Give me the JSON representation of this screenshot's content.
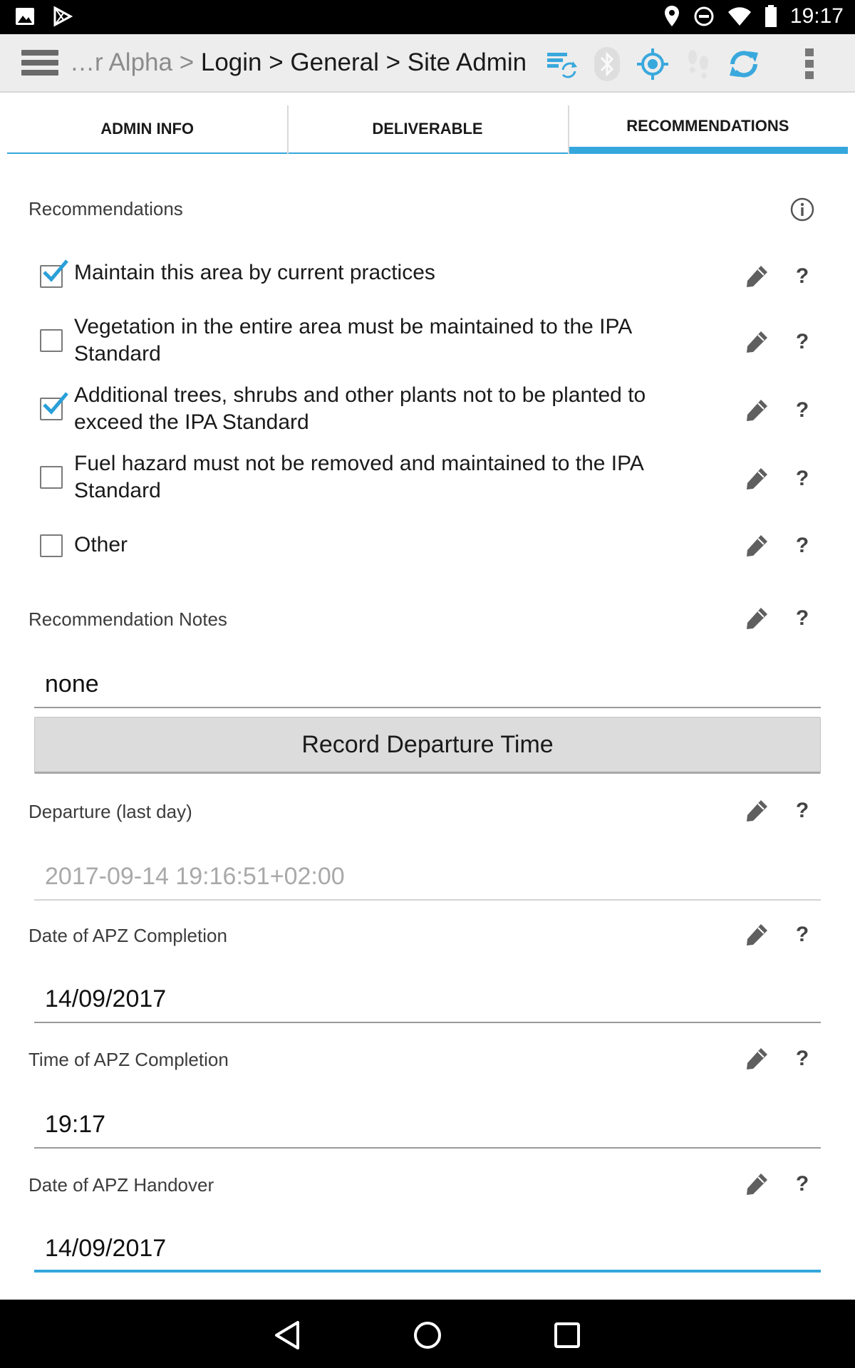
{
  "statusbar": {
    "time": "19:17"
  },
  "actionbar": {
    "breadcrumb_prefix": "…r Alpha > ",
    "breadcrumb_path": "Login > General > Site Admin"
  },
  "tabs": [
    {
      "label": "ADMIN INFO",
      "active": false
    },
    {
      "label": "DELIVERABLE",
      "active": false
    },
    {
      "label": "RECOMMENDATIONS",
      "active": true
    }
  ],
  "recommendations": {
    "label": "Recommendations",
    "items": [
      {
        "text": "Maintain this area by current practices",
        "checked": true
      },
      {
        "text": "Vegetation in the entire area must be maintained to the IPA Standard",
        "checked": false
      },
      {
        "text": "Additional trees, shrubs and other plants not to be planted to exceed the IPA Standard",
        "checked": true
      },
      {
        "text": "Fuel hazard must not be removed and maintained to the IPA Standard",
        "checked": false
      },
      {
        "text": "Other",
        "checked": false
      }
    ]
  },
  "fields": {
    "notes": {
      "label": "Recommendation Notes",
      "value": "none"
    },
    "record_button": "Record Departure Time",
    "departure": {
      "label": "Departure (last day)",
      "value": "2017-09-14 19:16:51+02:00"
    },
    "apz_date": {
      "label": "Date of APZ Completion",
      "value": "14/09/2017"
    },
    "apz_time": {
      "label": "Time of APZ Completion",
      "value": "19:17"
    },
    "handover": {
      "label": "Date of APZ Handover",
      "value": "14/09/2017"
    }
  },
  "help_glyph": "?",
  "icons": {
    "statusbar": [
      "image-icon",
      "play-store-icon",
      "location-pin-icon",
      "do-not-disturb-icon",
      "wifi-icon",
      "battery-icon"
    ],
    "actionbar": [
      "menu-icon",
      "sync-data-icon",
      "bluetooth-icon",
      "gps-target-icon",
      "footsteps-icon",
      "refresh-icon",
      "overflow-menu-icon"
    ],
    "field": [
      "pencil-icon",
      "help-icon",
      "info-icon"
    ],
    "nav": [
      "back-icon",
      "home-icon",
      "recents-icon"
    ]
  },
  "colors": {
    "accent": "#34a7dc",
    "checkmark": "#2a9fd8",
    "actionbar_bg": "#ededed",
    "button_bg": "#dcdcdc"
  }
}
